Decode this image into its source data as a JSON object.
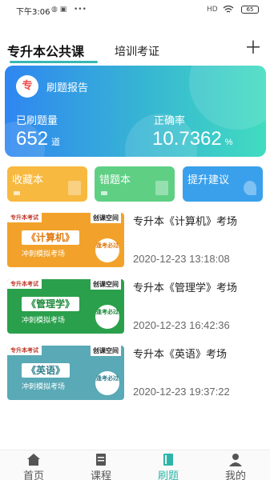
{
  "status_bar": {
    "time": "下午3:06",
    "signal": "HD",
    "battery": "65"
  },
  "tabs": {
    "active": "专升本公共课",
    "other": "培训考证",
    "add_icon": "plus-icon"
  },
  "report": {
    "badge": "专",
    "title": "刷题报告",
    "done_label": "已刷题量",
    "done_value": "652",
    "done_unit": "道",
    "accuracy_label": "正确率",
    "accuracy_value": "10.7362",
    "accuracy_unit": "%"
  },
  "quick": [
    {
      "label": "收藏本",
      "color": "#f7b93f"
    },
    {
      "label": "错题本",
      "color": "#5fcf84"
    },
    {
      "label": "提升建议",
      "color": "#3aa0ec"
    }
  ],
  "exams": [
    {
      "thumb_tag": "专升本考试",
      "thumb_brand": "创课空间",
      "thumb_subject": "《计算机》",
      "thumb_sub": "冲刺模拟考场",
      "thumb_stamp": "逢考必过",
      "thumb_color": "#f2a22b",
      "subject_color": "#e07a10",
      "title": "专升本《计算机》考场",
      "date": "2020-12-23 13:18:08"
    },
    {
      "thumb_tag": "专升本考试",
      "thumb_brand": "创课空间",
      "thumb_subject": "《管理学》",
      "thumb_sub": "冲刺模拟考场",
      "thumb_stamp": "逢考必过",
      "thumb_color": "#2aa04c",
      "subject_color": "#1e8a3d",
      "title": "专升本《管理学》考场",
      "date": "2020-12-23 16:42:36"
    },
    {
      "thumb_tag": "专升本考试",
      "thumb_brand": "创课空间",
      "thumb_subject": "《英语》",
      "thumb_sub": "冲刺模拟考场",
      "thumb_stamp": "逢考必过",
      "thumb_color": "#5aa9b6",
      "subject_color": "#2f7f8c",
      "title": "专升本《英语》考场",
      "date": "2020-12-23 19:37:22"
    }
  ],
  "nav": [
    {
      "label": "首页",
      "icon": "home-icon",
      "active": false
    },
    {
      "label": "课程",
      "icon": "document-icon",
      "active": false
    },
    {
      "label": "刷题",
      "icon": "book-icon",
      "active": true
    },
    {
      "label": "我的",
      "icon": "person-icon",
      "active": false
    }
  ],
  "colors": {
    "accent": "#35b9b2",
    "report_gradient_start": "#2f86f1",
    "report_gradient_end": "#41dcc0"
  }
}
